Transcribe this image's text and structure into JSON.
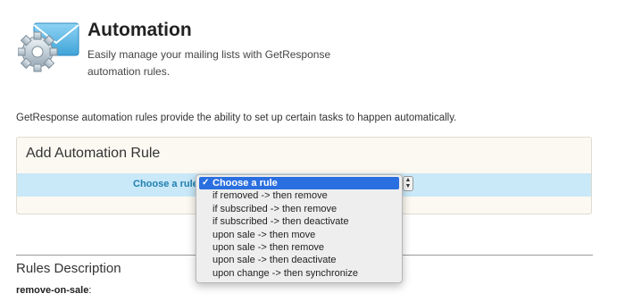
{
  "header": {
    "title": "Automation",
    "subtitle": "Easily manage your mailing lists with GetResponse automation rules.",
    "logo_icon": "envelope-gear-icon"
  },
  "intro_text": "GetResponse automation rules provide the ability to set up certain tasks to happen automatically.",
  "panel": {
    "title": "Add Automation Rule",
    "rule_label": "Choose a rule:",
    "select": {
      "selected": "Choose a rule",
      "options": [
        "Choose a rule",
        "if removed -> then remove",
        "if subscribed -> then remove",
        "if subscribed -> then deactivate",
        "upon sale -> then move",
        "upon sale -> then remove",
        "upon sale -> then deactivate",
        "upon change -> then synchronize"
      ]
    }
  },
  "rules_description": {
    "title": "Rules Description",
    "first_item": "remove-on-sale",
    "first_item_suffix": ":"
  },
  "colors": {
    "row_highlight": "#c9e8f8",
    "label_blue": "#1e7fb0",
    "selection_blue": "#2a6fe0",
    "panel_bg": "#fbf9f1"
  }
}
